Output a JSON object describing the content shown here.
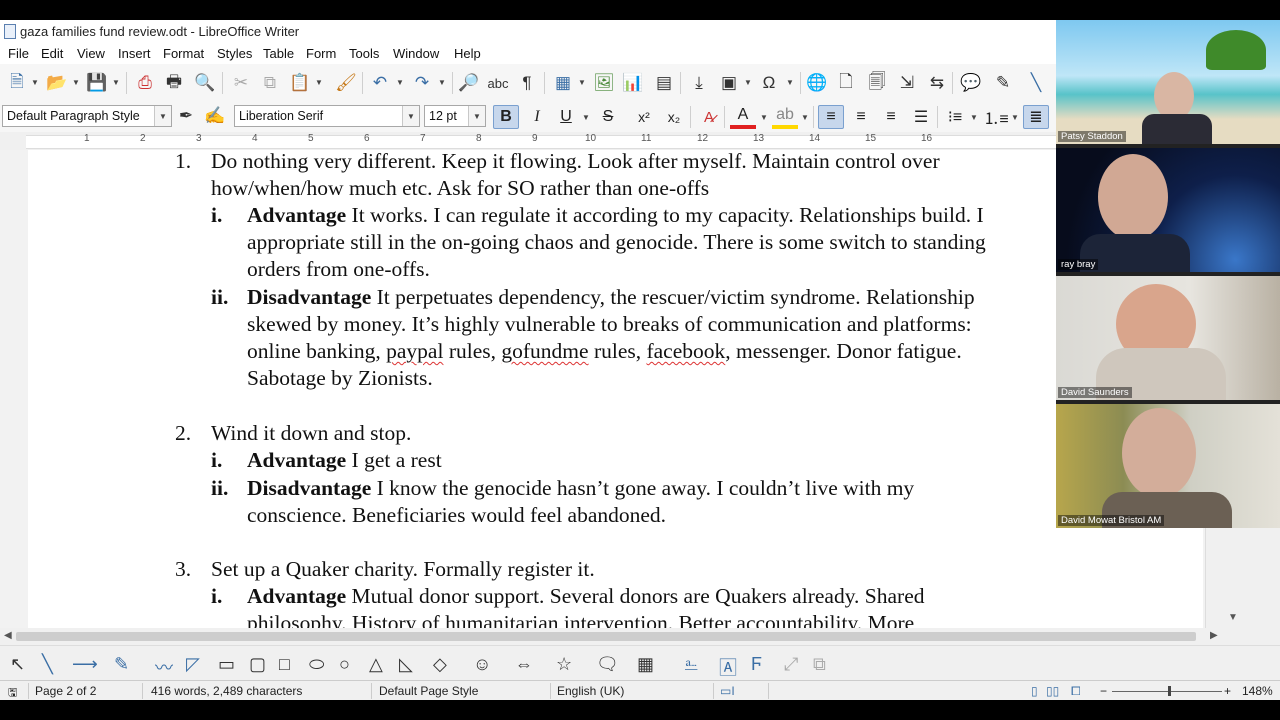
{
  "window": {
    "title": "gaza families fund review.odt - LibreOffice Writer"
  },
  "menu": [
    "File",
    "Edit",
    "View",
    "Insert",
    "Format",
    "Styles",
    "Table",
    "Form",
    "Tools",
    "Window",
    "Help"
  ],
  "formatting": {
    "paragraph_style": "Default Paragraph Style",
    "font_name": "Liberation Serif",
    "font_size": "12 pt",
    "bold_label": "B",
    "italic_label": "I",
    "underline_label": "U",
    "strike_label": "S",
    "superscript_label": "x²",
    "subscript_label": "x₂"
  },
  "ruler": {
    "numbers": [
      "1",
      "2",
      "3",
      "4",
      "5",
      "6",
      "7",
      "8",
      "9",
      "10",
      "11",
      "12",
      "13",
      "14",
      "15",
      "16"
    ]
  },
  "document": {
    "item1": {
      "num": "1.",
      "line1": "Do nothing very different. Keep it flowing. Look after myself. Maintain control over",
      "line2": "how/when/how much etc. Ask for SO rather than one-offs",
      "sub_i_num": "i.",
      "sub_i_label": "Advantage",
      "sub_i_line1": " It works. I can regulate it according to my capacity. Relationships build. I",
      "sub_i_line2": "appropriate still in the on-going chaos and genocide. There is some switch to standing",
      "sub_i_line3": "orders from one-offs.",
      "sub_ii_num": "ii.",
      "sub_ii_label": "Disadvantage",
      "sub_ii_line1": " It perpetuates dependency, the rescuer/victim syndrome. Relationship",
      "sub_ii_line2": "skewed by money. It’s highly vulnerable to breaks of communication and platforms:",
      "sub_ii_line3_a": "online banking, ",
      "sub_ii_line3_b": "paypal",
      "sub_ii_line3_c": " rules, ",
      "sub_ii_line3_d": "gofundme",
      "sub_ii_line3_e": " rules, ",
      "sub_ii_line3_f": "facebook",
      "sub_ii_line3_g": ", messenger. Donor fatigue.",
      "sub_ii_line4": "Sabotage by Zionists."
    },
    "item2": {
      "num": "2.",
      "line1": "Wind it down and stop.",
      "sub_i_num": "i.",
      "sub_i_label": "Advantage",
      "sub_i_line1": " I get a rest",
      "sub_ii_num": "ii.",
      "sub_ii_label": "Disadvantage",
      "sub_ii_line1": " I know the genocide hasn’t gone away. I couldn’t live with my",
      "sub_ii_line2": "conscience. Beneficiaries would feel abandoned."
    },
    "item3": {
      "num": "3.",
      "line1": "Set up a Quaker charity. Formally register it.",
      "sub_i_num": "i.",
      "sub_i_label": "Advantage",
      "sub_i_line1": " Mutual donor support. Several donors are Quakers already. Shared",
      "sub_i_line2": "philosophy. History of humanitarian intervention. Better accountability. More"
    }
  },
  "status": {
    "page": "Page 2 of 2",
    "words": "416 words, 2,489 characters",
    "page_style": "Default Page Style",
    "language": "English (UK)",
    "zoom": "148%"
  },
  "participants": [
    "Patsy Staddon",
    "ray bray",
    "David Saunders",
    "David Mowat Bristol AM"
  ],
  "colors": {
    "accent": "#3a6ea5",
    "font_color": "#e02020",
    "highlight": "#ffd800"
  }
}
